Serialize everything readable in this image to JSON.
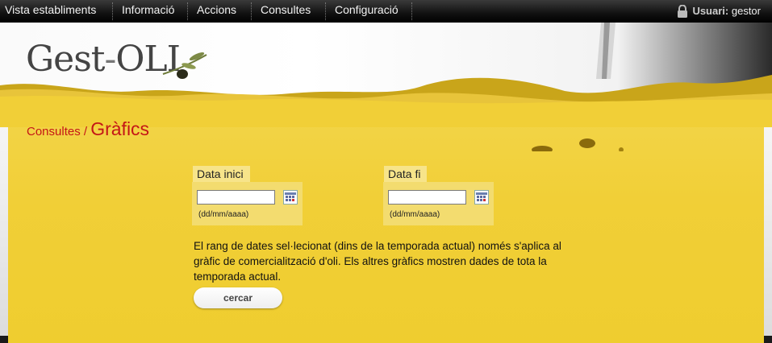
{
  "menu": {
    "items": [
      {
        "label": "Vista establiments"
      },
      {
        "label": "Informació"
      },
      {
        "label": "Accions"
      },
      {
        "label": "Consultes"
      },
      {
        "label": "Configuració"
      }
    ],
    "user_label": "Usuari:",
    "user_name": "gestor"
  },
  "logo": {
    "text_left": "Gest",
    "text_dash": "-",
    "text_right": "OLI"
  },
  "breadcrumb": {
    "parent": "Consultes",
    "separator": "/",
    "current": "Gràfics"
  },
  "form": {
    "start": {
      "label": "Data inici",
      "value": "",
      "hint": "(dd/mm/aaaa)"
    },
    "end": {
      "label": "Data fi",
      "value": "",
      "hint": "(dd/mm/aaaa)"
    },
    "note": "El rang de dates sel·lecionat (dins de la temporada actual) només s'aplica al gràfic de comercialització d'oli. Els altres gràfics mostren dades de tota la temporada actual.",
    "submit_label": "cercar"
  },
  "colors": {
    "accent_red": "#c41616",
    "panel_yellow": "#f1cf37"
  }
}
